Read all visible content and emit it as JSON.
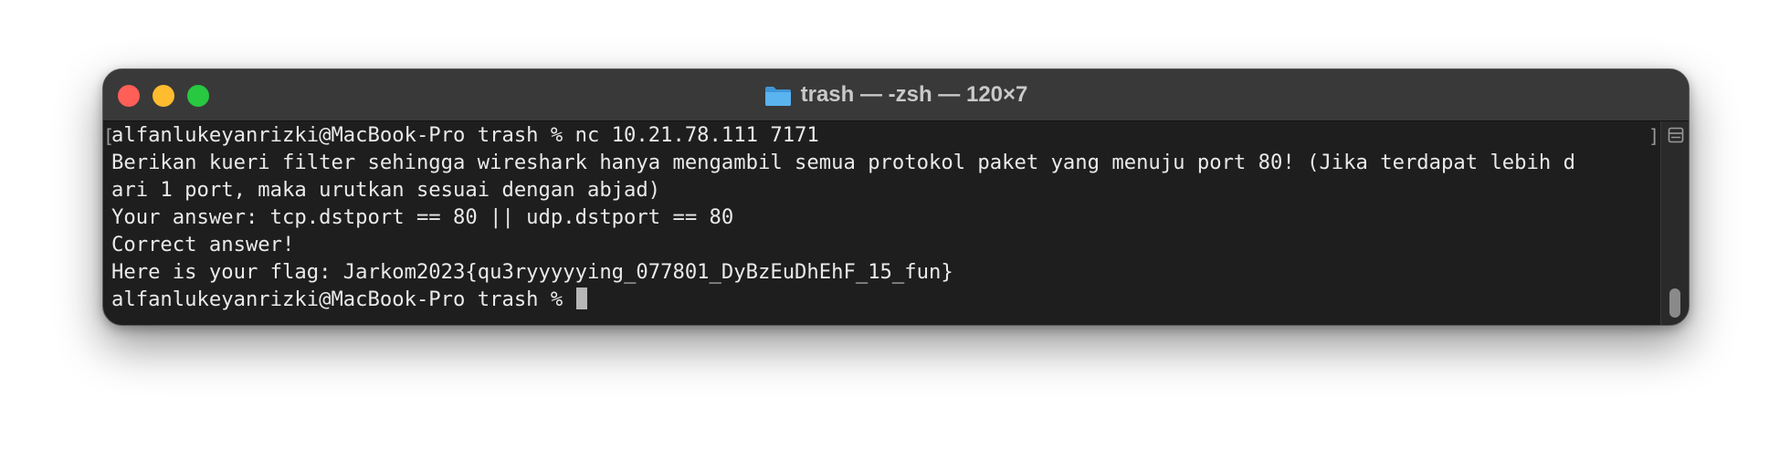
{
  "window": {
    "title": "trash — -zsh — 120×7"
  },
  "terminal": {
    "lines": [
      "alfanlukeyanrizki@MacBook-Pro trash % nc 10.21.78.111 7171",
      "Berikan kueri filter sehingga wireshark hanya mengambil semua protokol paket yang menuju port 80! (Jika terdapat lebih d",
      "ari 1 port, maka urutkan sesuai dengan abjad)",
      "Your answer: tcp.dstport == 80 || udp.dstport == 80",
      "Correct answer!",
      "Here is your flag: Jarkom2023{qu3ryyyyying_077801_DyBzEuDhEhF_15_fun}",
      "alfanlukeyanrizki@MacBook-Pro trash % "
    ]
  },
  "icons": {
    "folder": "folder-icon",
    "split": "split-view-icon"
  },
  "colors": {
    "close": "#ff5f57",
    "minimize": "#febc2e",
    "zoom": "#28c840",
    "folder": "#5ab4f0",
    "background": "#1e1e1e",
    "text": "#eaeaea"
  }
}
